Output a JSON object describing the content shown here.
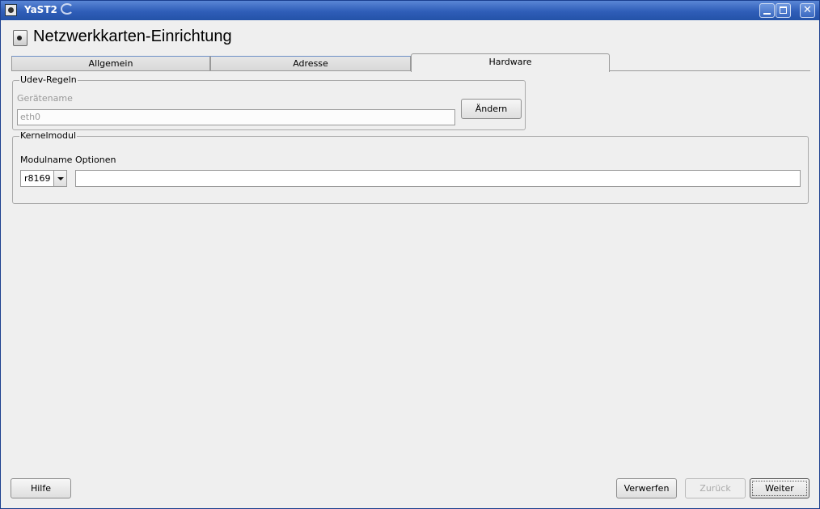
{
  "window": {
    "title": "YaST2"
  },
  "header": {
    "title": "Netzwerkkarten-Einrichtung"
  },
  "tabs": [
    {
      "label": "Allgemein"
    },
    {
      "label": "Adresse"
    },
    {
      "label": "Hardware"
    }
  ],
  "udev": {
    "title": "Udev-Regeln",
    "device_name_label": "Gerätename",
    "device_name_value": "eth0",
    "change_button": "Ändern"
  },
  "kernel": {
    "title": "Kernelmodul",
    "module_label": "Modulname",
    "options_label": "Optionen",
    "module_value": "r8169",
    "options_value": ""
  },
  "footer": {
    "help": "Hilfe",
    "discard": "Verwerfen",
    "back": "Zurück",
    "next": "Weiter"
  }
}
